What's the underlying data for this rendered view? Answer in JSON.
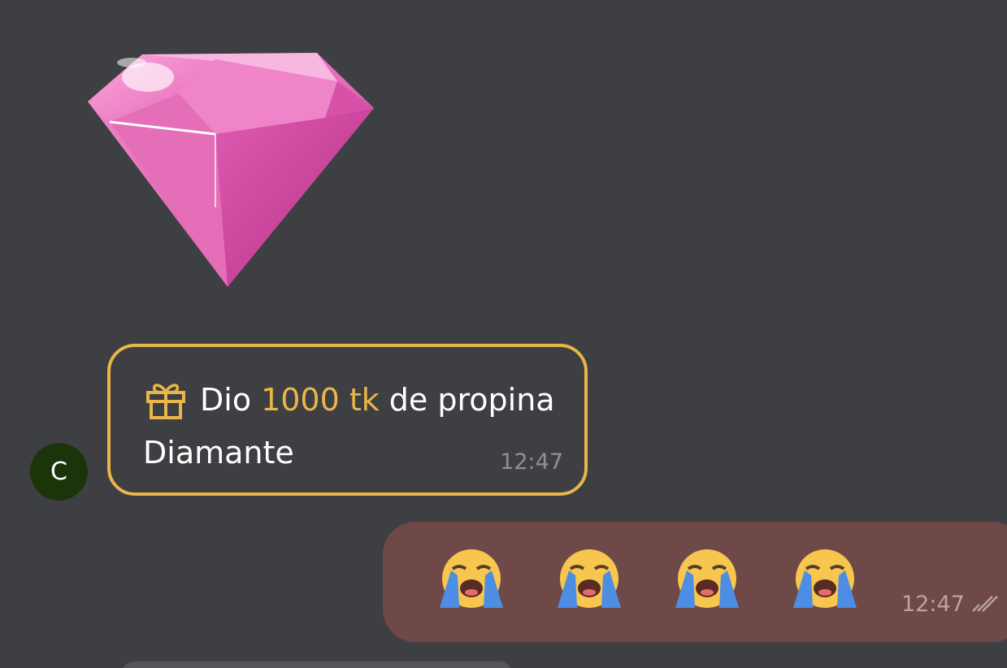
{
  "messages": {
    "incoming": {
      "avatar_initial": "C",
      "sticker_icon": "pink-diamond-icon",
      "tip_prefix": "Dio",
      "tip_amount": "1000 tk",
      "tip_suffix": "de propina",
      "tip_subtitle": "Diamante",
      "time": "12:47",
      "gift_icon": "gift-icon"
    },
    "outgoing": {
      "emojis": [
        "loudly-crying-face-icon",
        "loudly-crying-face-icon",
        "loudly-crying-face-icon",
        "loudly-crying-face-icon"
      ],
      "time": "12:47",
      "status_icon": "double-check-icon"
    }
  },
  "colors": {
    "background": "#3e3f43",
    "tip_border": "#e8b64a",
    "tip_amount": "#e8b64a",
    "outgoing_bubble": "#6f4848",
    "avatar": "#1c3409"
  }
}
